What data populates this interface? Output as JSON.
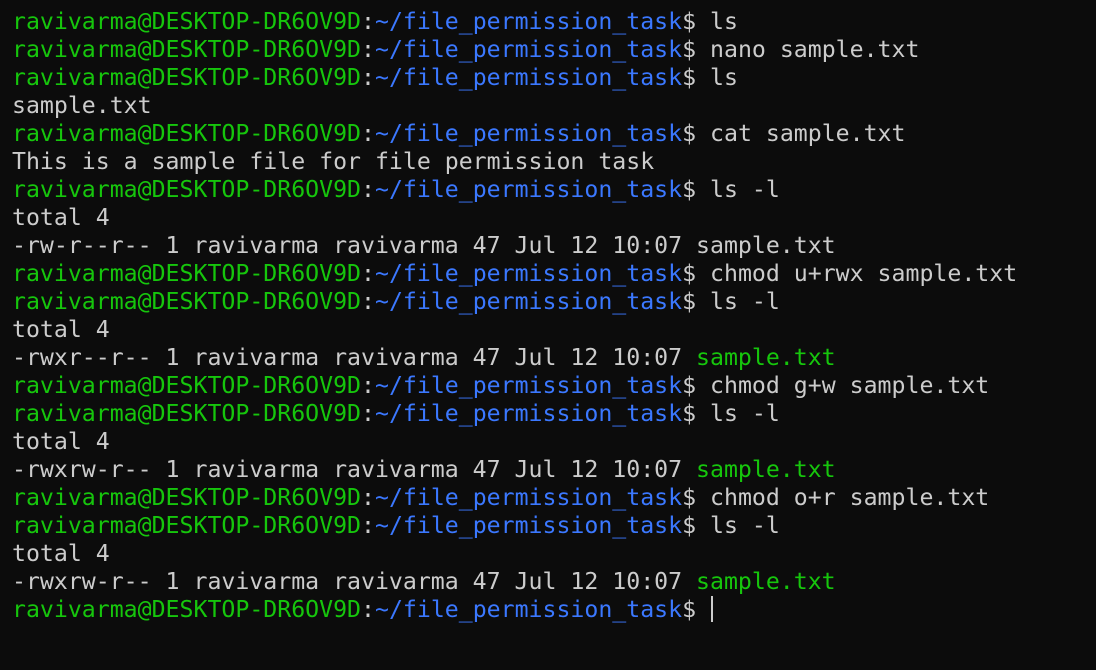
{
  "prompt": {
    "user_host": "ravivarma@DESKTOP-DR6OV9D",
    "colon": ":",
    "path": "~/file_permission_task",
    "symbol": "$"
  },
  "lines": [
    {
      "type": "command",
      "text": " ls"
    },
    {
      "type": "command",
      "text": " nano sample.txt"
    },
    {
      "type": "command",
      "text": " ls"
    },
    {
      "type": "output",
      "text": "sample.txt"
    },
    {
      "type": "command",
      "text": " cat sample.txt"
    },
    {
      "type": "output",
      "text": "This is a sample file for file permission task"
    },
    {
      "type": "command",
      "text": " ls -l"
    },
    {
      "type": "output",
      "text": "total 4"
    },
    {
      "type": "listing",
      "text": "-rw-r--r-- 1 ravivarma ravivarma 47 Jul 12 10:07 ",
      "file": "sample.txt",
      "executable": false
    },
    {
      "type": "command",
      "text": " chmod u+rwx sample.txt"
    },
    {
      "type": "command",
      "text": " ls -l"
    },
    {
      "type": "output",
      "text": "total 4"
    },
    {
      "type": "listing",
      "text": "-rwxr--r-- 1 ravivarma ravivarma 47 Jul 12 10:07 ",
      "file": "sample.txt",
      "executable": true
    },
    {
      "type": "command",
      "text": " chmod g+w sample.txt"
    },
    {
      "type": "command",
      "text": " ls -l"
    },
    {
      "type": "output",
      "text": "total 4"
    },
    {
      "type": "listing",
      "text": "-rwxrw-r-- 1 ravivarma ravivarma 47 Jul 12 10:07 ",
      "file": "sample.txt",
      "executable": true
    },
    {
      "type": "command",
      "text": " chmod o+r sample.txt"
    },
    {
      "type": "command",
      "text": " ls -l"
    },
    {
      "type": "output",
      "text": "total 4"
    },
    {
      "type": "listing",
      "text": "-rwxrw-r-- 1 ravivarma ravivarma 47 Jul 12 10:07 ",
      "file": "sample.txt",
      "executable": true
    },
    {
      "type": "input",
      "text": " "
    }
  ],
  "colors": {
    "background": "#0c0c0c",
    "prompt_user": "#16c60c",
    "prompt_path": "#3b78ff",
    "text": "#cccccc",
    "executable_file": "#16c60c"
  }
}
